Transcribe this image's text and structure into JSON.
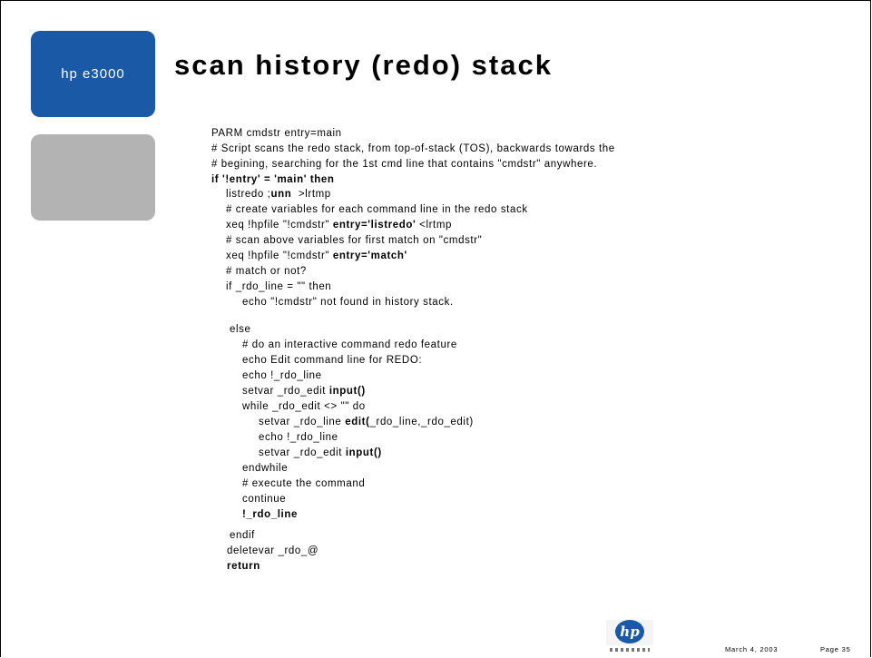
{
  "badge": {
    "text": "hp e3000"
  },
  "title": "scan history (redo) stack",
  "code_lines": [
    {
      "segments": [
        {
          "text": "PARM cmdstr entry=main",
          "bold": false
        }
      ]
    },
    {
      "segments": [
        {
          "text": "# Script scans the redo stack, from top-of-stack (TOS), backwards towards the",
          "bold": false
        }
      ]
    },
    {
      "segments": [
        {
          "text": "# begining, searching for the 1st cmd line that contains \"cmdstr\" anywhere.",
          "bold": false
        }
      ]
    },
    {
      "segments": [
        {
          "text": "if '!entry' = 'main' then",
          "bold": true
        }
      ]
    },
    {
      "segments": [
        {
          "text": "listredo ;",
          "bold": false
        },
        {
          "text": "unn",
          "bold": true
        },
        {
          "text": "  >lrtmp",
          "bold": false
        }
      ]
    },
    {
      "segments": [
        {
          "text": "# create variables for each command line in the redo stack",
          "bold": false
        }
      ]
    },
    {
      "segments": [
        {
          "text": "xeq !hpfile \"!cmdstr\" ",
          "bold": false
        },
        {
          "text": "entry='listredo'",
          "bold": true
        },
        {
          "text": " <lrtmp",
          "bold": false
        }
      ]
    },
    {
      "segments": [
        {
          "text": "# scan above variables for first match on \"cmdstr\"",
          "bold": false
        }
      ]
    },
    {
      "segments": [
        {
          "text": "xeq !hpfile \"!cmdstr\" ",
          "bold": false
        },
        {
          "text": "entry='match'",
          "bold": true
        }
      ]
    },
    {
      "segments": [
        {
          "text": "# match or not?",
          "bold": false
        }
      ]
    },
    {
      "segments": [
        {
          "text": "if _rdo_line = \"\" then",
          "bold": false
        }
      ]
    },
    {
      "segments": [
        {
          "text": "echo \"!cmdstr\" not found in history stack.",
          "bold": false
        }
      ]
    },
    {
      "segments": [
        {
          "text": "else",
          "bold": false
        }
      ]
    },
    {
      "segments": [
        {
          "text": "# do an interactive command redo feature",
          "bold": false
        }
      ]
    },
    {
      "segments": [
        {
          "text": "echo Edit command line for REDO:",
          "bold": false
        }
      ]
    },
    {
      "segments": [
        {
          "text": "echo !_rdo_line",
          "bold": false
        }
      ]
    },
    {
      "segments": [
        {
          "text": "setvar _rdo_edit ",
          "bold": false
        },
        {
          "text": "input()",
          "bold": true
        }
      ]
    },
    {
      "segments": [
        {
          "text": "while _rdo_edit <> \"\" do",
          "bold": false
        }
      ]
    },
    {
      "segments": [
        {
          "text": "setvar _rdo_line ",
          "bold": false
        },
        {
          "text": "edit(",
          "bold": true
        },
        {
          "text": "_rdo_line,_rdo_edit)",
          "bold": false
        }
      ]
    },
    {
      "segments": [
        {
          "text": "echo !_rdo_line",
          "bold": false
        }
      ]
    },
    {
      "segments": [
        {
          "text": "setvar _rdo_edit ",
          "bold": false
        },
        {
          "text": "input()",
          "bold": true
        }
      ]
    },
    {
      "segments": [
        {
          "text": "endwhile",
          "bold": false
        }
      ]
    },
    {
      "segments": [
        {
          "text": "# execute the command",
          "bold": false
        }
      ]
    },
    {
      "segments": [
        {
          "text": "continue",
          "bold": false
        }
      ]
    },
    {
      "segments": [
        {
          "text": "!_rdo_line",
          "bold": true
        }
      ]
    },
    {
      "segments": [
        {
          "text": "endif",
          "bold": false
        }
      ]
    },
    {
      "segments": [
        {
          "text": "deletevar _rdo_@",
          "bold": false
        }
      ]
    },
    {
      "segments": [
        {
          "text": "return",
          "bold": true
        }
      ]
    }
  ],
  "logo": {
    "text": "hp",
    "icon": "hp-invent-logo"
  },
  "footer": {
    "date": "March 4, 2003",
    "page": "Page 35"
  },
  "colors": {
    "brand_blue": "#1a59a6",
    "gray_block": "#b3b3b3"
  }
}
